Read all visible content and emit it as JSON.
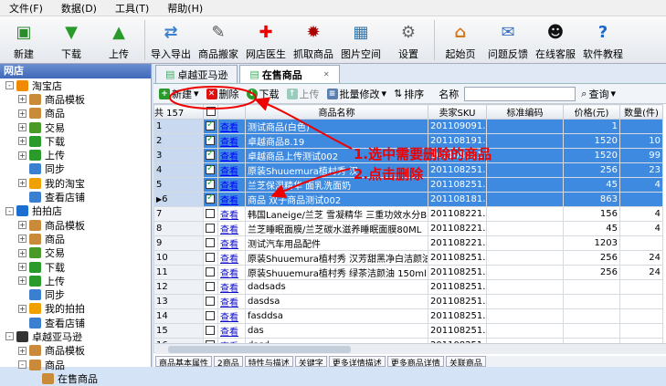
{
  "menu": [
    "文件(F)",
    "数据(D)",
    "工具(T)",
    "帮助(H)"
  ],
  "toolbar": [
    {
      "label": "新建",
      "icon": "new-doc-icon",
      "color": "#2c8b2c",
      "glyph": "▣"
    },
    {
      "label": "下载",
      "icon": "download-icon",
      "color": "#2a9a2a",
      "glyph": "▼"
    },
    {
      "label": "上传",
      "icon": "upload-icon",
      "color": "#2a9a2a",
      "glyph": "▲"
    },
    {
      "label": "导入导出",
      "icon": "import-export-icon",
      "color": "#3a7fd0",
      "glyph": "⇄"
    },
    {
      "label": "商品搬家",
      "icon": "move-goods-icon",
      "color": "#555",
      "glyph": "✎"
    },
    {
      "label": "网店医生",
      "icon": "doctor-cross-icon",
      "color": "#e00",
      "glyph": "✚"
    },
    {
      "label": "抓取商品",
      "icon": "spider-icon",
      "color": "#a00",
      "glyph": "✹"
    },
    {
      "label": "图片空间",
      "icon": "image-space-icon",
      "color": "#37a",
      "glyph": "▦"
    },
    {
      "label": "设置",
      "icon": "gear-icon",
      "color": "#666",
      "glyph": "⚙"
    },
    {
      "label": "起始页",
      "icon": "home-icon",
      "color": "#d67a20",
      "glyph": "⌂"
    },
    {
      "label": "问题反馈",
      "icon": "feedback-icon",
      "color": "#3b6fc0",
      "glyph": "✉"
    },
    {
      "label": "在线客服",
      "icon": "qq-icon",
      "color": "#111",
      "glyph": "☻"
    },
    {
      "label": "软件教程",
      "icon": "help-icon",
      "color": "#1b68c8",
      "glyph": "?"
    }
  ],
  "sidebar": {
    "title": "网店",
    "tree": [
      {
        "label": "淘宝店",
        "level": 0,
        "exp": "-",
        "color": "#f08a00"
      },
      {
        "label": "商品模板",
        "level": 1,
        "exp": "+",
        "color": "#c98a3a"
      },
      {
        "label": "商品",
        "level": 1,
        "exp": "+",
        "color": "#c98a3a"
      },
      {
        "label": "交易",
        "level": 1,
        "exp": "+",
        "color": "#4a9a2a"
      },
      {
        "label": "下载",
        "level": 1,
        "exp": "+",
        "color": "#2a9a2a"
      },
      {
        "label": "上传",
        "level": 1,
        "exp": "+",
        "color": "#2a9a2a"
      },
      {
        "label": "同步",
        "level": 1,
        "exp": "",
        "color": "#3a7fd0"
      },
      {
        "label": "我的淘宝",
        "level": 1,
        "exp": "+",
        "color": "#f0a000"
      },
      {
        "label": "查看店铺",
        "level": 1,
        "exp": "",
        "color": "#3a7fd0"
      },
      {
        "label": "拍拍店",
        "level": 0,
        "exp": "-",
        "color": "#1a6fd0"
      },
      {
        "label": "商品模板",
        "level": 1,
        "exp": "+",
        "color": "#c98a3a"
      },
      {
        "label": "商品",
        "level": 1,
        "exp": "+",
        "color": "#c98a3a"
      },
      {
        "label": "交易",
        "level": 1,
        "exp": "+",
        "color": "#4a9a2a"
      },
      {
        "label": "下载",
        "level": 1,
        "exp": "+",
        "color": "#2a9a2a"
      },
      {
        "label": "上传",
        "level": 1,
        "exp": "+",
        "color": "#2a9a2a"
      },
      {
        "label": "同步",
        "level": 1,
        "exp": "",
        "color": "#3a7fd0"
      },
      {
        "label": "我的拍拍",
        "level": 1,
        "exp": "+",
        "color": "#f0a000"
      },
      {
        "label": "查看店铺",
        "level": 1,
        "exp": "",
        "color": "#3a7fd0"
      },
      {
        "label": "卓越亚马逊",
        "level": 0,
        "exp": "-",
        "color": "#333"
      },
      {
        "label": "商品模板",
        "level": 1,
        "exp": "+",
        "color": "#c98a3a"
      },
      {
        "label": "商品",
        "level": 1,
        "exp": "-",
        "color": "#c98a3a"
      },
      {
        "label": "在售商品",
        "level": 2,
        "exp": "",
        "color": "#c98a3a"
      }
    ]
  },
  "tabs": [
    {
      "label": "卓越亚马逊",
      "active": false
    },
    {
      "label": "在售商品",
      "active": true
    }
  ],
  "gridbar": {
    "new": "新建",
    "delete": "删除",
    "download": "下载",
    "upload": "上传",
    "batch": "批量修改",
    "sort": "排序",
    "name_label": "名称",
    "search": "查询"
  },
  "grid": {
    "count_label": "共 157",
    "columns": [
      "",
      "",
      "",
      "商品名称",
      "卖家SKU",
      "标准编码",
      "价格(元)",
      "数量(件)"
    ],
    "view_label": "查看",
    "rows": [
      {
        "n": "1",
        "checked": true,
        "sel": true,
        "name": "测试商品(白色)",
        "sku": "201109091...",
        "code": "",
        "price": "1",
        "qty": ""
      },
      {
        "n": "2",
        "checked": true,
        "sel": true,
        "name": "卓越商品8.19",
        "sku": "201108191...",
        "code": "",
        "price": "1520",
        "qty": "10"
      },
      {
        "n": "3",
        "checked": true,
        "sel": true,
        "name": "卓越商品上传测试002",
        "sku": "201108181...",
        "code": "",
        "price": "1520",
        "qty": "99"
      },
      {
        "n": "4",
        "checked": true,
        "sel": true,
        "name": "原装Shuuemura植村秀 汉",
        "sku": "201108251...",
        "code": "",
        "price": "256",
        "qty": "23"
      },
      {
        "n": "5",
        "checked": true,
        "sel": true,
        "name": "兰芝保湿精华 面乳洗面奶",
        "sku": "201108251...",
        "code": "",
        "price": "45",
        "qty": "4"
      },
      {
        "n": "6",
        "checked": true,
        "sel": true,
        "name": "商品 双子商品测试002",
        "sku": "201108181...",
        "code": "",
        "price": "863",
        "qty": ""
      },
      {
        "n": "7",
        "checked": false,
        "sel": false,
        "name": "韩国Laneige/兰芝 雪凝精华 三重功效水分BB霜",
        "sku": "201108221...",
        "code": "",
        "price": "156",
        "qty": "4"
      },
      {
        "n": "8",
        "checked": false,
        "sel": false,
        "name": "兰芝睡眠面膜/兰芝碳水滋养睡眠面膜80ML",
        "sku": "201108221...",
        "code": "",
        "price": "45",
        "qty": "4"
      },
      {
        "n": "9",
        "checked": false,
        "sel": false,
        "name": "测试汽车用品配件",
        "sku": "201108221...",
        "code": "",
        "price": "1203",
        "qty": ""
      },
      {
        "n": "10",
        "checked": false,
        "sel": false,
        "name": "原装Shuuemura植村秀 汉芳甜黑净白洁颜油",
        "sku": "201108251...",
        "code": "",
        "price": "256",
        "qty": "24"
      },
      {
        "n": "11",
        "checked": false,
        "sel": false,
        "name": "原装Shuuemura植村秀 绿茶洁颜油 150ml 8-25",
        "sku": "201108251...",
        "code": "",
        "price": "256",
        "qty": "24"
      },
      {
        "n": "12",
        "checked": false,
        "sel": false,
        "name": "dadsads",
        "sku": "201108251...",
        "code": "",
        "price": "",
        "qty": ""
      },
      {
        "n": "13",
        "checked": false,
        "sel": false,
        "name": "dasdsa",
        "sku": "201108251...",
        "code": "",
        "price": "",
        "qty": ""
      },
      {
        "n": "14",
        "checked": false,
        "sel": false,
        "name": "fasddsa",
        "sku": "201108251...",
        "code": "",
        "price": "",
        "qty": ""
      },
      {
        "n": "15",
        "checked": false,
        "sel": false,
        "name": "das",
        "sku": "201108251...",
        "code": "",
        "price": "",
        "qty": ""
      },
      {
        "n": "16",
        "checked": false,
        "sel": false,
        "name": "dasd",
        "sku": "201108251...",
        "code": "",
        "price": "",
        "qty": ""
      }
    ]
  },
  "bottom_tabs": [
    "商品基本属性",
    "2商品",
    "特性与描述",
    "关键字",
    "更多详情描述",
    "更多商品详情",
    "关联商品"
  ],
  "annotation": {
    "line1": "1.选中需要删除的商品",
    "line2": "2.点击删除"
  },
  "colors": {
    "selected_row": "#3d8ae0",
    "annotation": "#e00000",
    "link": "#0b0bd0"
  }
}
